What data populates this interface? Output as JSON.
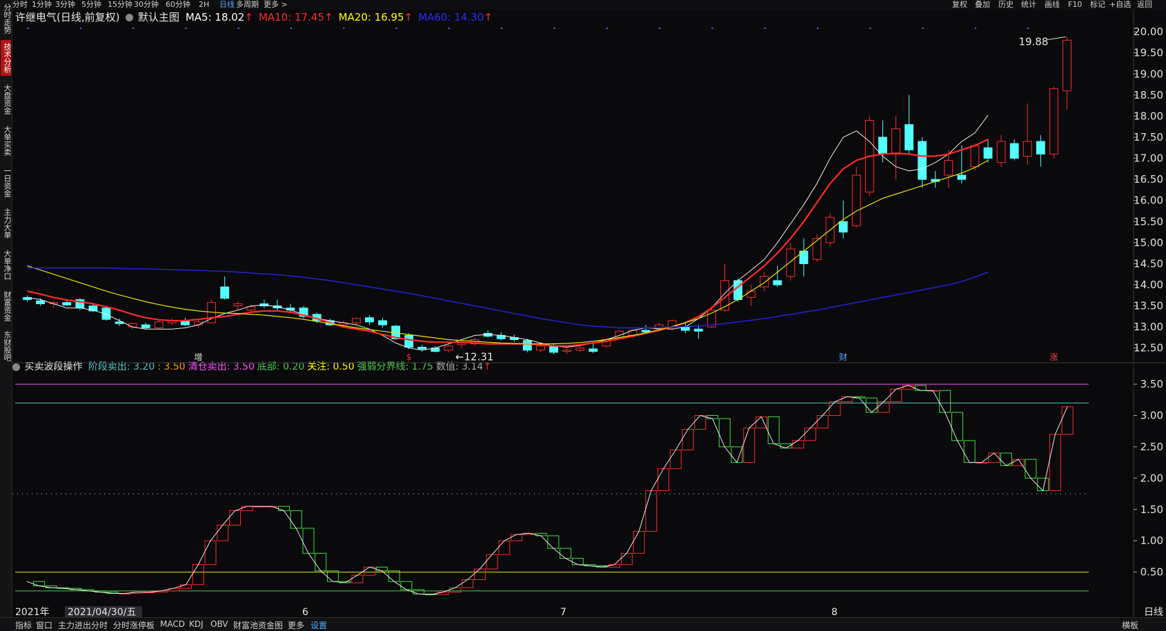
{
  "topbar": {
    "left": [
      "分时",
      "1分钟",
      "3分钟",
      "5分钟",
      "15分钟",
      "30分钟",
      "60分钟",
      "2H",
      "日线",
      "多周期",
      "更多 >"
    ],
    "active": "日线",
    "right": [
      "复权",
      "叠加",
      "历史",
      "统计",
      "画线",
      "F10",
      "标记",
      "+自选",
      "返回"
    ]
  },
  "sidebar": [
    "分时走势",
    "技术分析",
    "大盘资金",
    "大单买卖",
    "一日资金",
    "主力大单",
    "大单净口",
    "财富资金",
    "东财股吧"
  ],
  "sidebar_active": "技术分析",
  "main_chart": {
    "title": "许继电气(日线,前复权)",
    "template": "默认主图",
    "ma": [
      {
        "label": "MA5: 18.02",
        "color": "#ffffff"
      },
      {
        "label": "MA10: 17.45",
        "color": "#ff2a2a"
      },
      {
        "label": "MA20: 16.95",
        "color": "#ffff00"
      },
      {
        "label": "MA60: 14.30",
        "color": "#2a2aff"
      }
    ],
    "high_label": "19.88",
    "low_label": "12.31",
    "markers": [
      "增",
      "$",
      "财",
      "涨"
    ],
    "price_ticks": [
      "20.00",
      "19.50",
      "19.00",
      "18.50",
      "18.00",
      "17.50",
      "17.00",
      "16.50",
      "16.00",
      "15.50",
      "15.00",
      "14.50",
      "14.00",
      "13.50",
      "13.00",
      "12.50"
    ]
  },
  "indicator": {
    "name": "买卖波段操作",
    "params": [
      {
        "label": "阶段卖出: 3.20",
        "color": "#50c8c8"
      },
      {
        "label": ": 3.50",
        "color": "#ff9900"
      },
      {
        "label": "清仓卖出: 3.50",
        "color": "#ff50ff"
      },
      {
        "label": "底部: 0.20",
        "color": "#50c850"
      },
      {
        "label": "关注: 0.50",
        "color": "#ffff00"
      },
      {
        "label": "强弱分界线: 1.75",
        "color": "#50c850"
      },
      {
        "label": "数值: 3.14",
        "color": "#aaaaaa"
      }
    ],
    "ticks": [
      "3.50",
      "3.00",
      "2.50",
      "2.00",
      "1.50",
      "1.00",
      "0.50"
    ]
  },
  "x_axis": {
    "labels": [
      "2021年",
      "2021/04/30/五",
      "6",
      "7",
      "8"
    ],
    "period": "日线"
  },
  "bottombar": {
    "items": [
      "指标",
      "窗口",
      "主力进出分时",
      "分时涨停板",
      "MACD",
      "KDJ",
      "OBV",
      "财富池资金图",
      "更多",
      "设置"
    ],
    "right": "横板"
  },
  "colors": {
    "up": "#ff2a2a",
    "down": "#54ffff",
    "bg": "#0a0a0c",
    "accent": "#5aa8ff"
  },
  "chart_data": [
    {
      "type": "candlestick",
      "title": "许继电气(日线,前复权)",
      "series": [
        {
          "name": "MA5",
          "values": [
            13.7,
            13.65,
            13.55,
            13.45,
            13.45,
            13.4,
            13.3,
            13.15,
            13.0,
            12.95,
            12.95,
            12.95,
            12.98,
            13.05,
            13.2,
            13.32,
            13.4,
            13.5,
            13.52,
            13.48,
            13.4,
            13.3,
            13.2,
            13.15,
            13.1,
            13.05,
            12.95,
            12.8,
            12.62,
            12.5,
            12.45,
            12.5,
            12.6,
            12.7,
            12.8,
            12.82,
            12.8,
            12.75,
            12.7,
            12.62,
            12.55,
            12.52,
            12.56,
            12.62,
            12.7,
            12.8,
            12.92,
            12.98,
            12.96,
            12.95,
            13.0,
            13.2,
            13.45,
            13.8,
            14.1,
            14.35,
            14.6,
            15.0,
            15.45,
            15.9,
            16.4,
            17.0,
            17.5,
            17.65,
            17.4,
            17.05,
            16.8,
            16.7,
            16.75,
            16.9,
            17.1,
            17.4,
            17.6,
            18.02
          ]
        },
        {
          "name": "MA10",
          "values": [
            13.85,
            13.78,
            13.7,
            13.64,
            13.6,
            13.55,
            13.48,
            13.4,
            13.3,
            13.22,
            13.17,
            13.15,
            13.15,
            13.18,
            13.22,
            13.25,
            13.3,
            13.35,
            13.38,
            13.38,
            13.35,
            13.28,
            13.2,
            13.1,
            13.0,
            12.95,
            12.9,
            12.82,
            12.75,
            12.7,
            12.66,
            12.64,
            12.64,
            12.64,
            12.62,
            12.6,
            12.6,
            12.6,
            12.6,
            12.58,
            12.55,
            12.55,
            12.58,
            12.62,
            12.66,
            12.72,
            12.78,
            12.85,
            12.92,
            13.0,
            13.1,
            13.25,
            13.45,
            13.7,
            13.95,
            14.2,
            14.45,
            14.75,
            15.1,
            15.5,
            15.95,
            16.4,
            16.75,
            16.95,
            17.05,
            17.1,
            17.12,
            17.1,
            17.05,
            17.05,
            17.1,
            17.2,
            17.3,
            17.45
          ]
        },
        {
          "name": "MA20",
          "values": [
            14.45,
            14.35,
            14.25,
            14.15,
            14.05,
            13.95,
            13.85,
            13.76,
            13.68,
            13.6,
            13.53,
            13.47,
            13.42,
            13.38,
            13.35,
            13.33,
            13.32,
            13.3,
            13.28,
            13.25,
            13.22,
            13.18,
            13.13,
            13.08,
            13.03,
            12.98,
            12.94,
            12.9,
            12.86,
            12.82,
            12.78,
            12.74,
            12.7,
            12.68,
            12.66,
            12.64,
            12.62,
            12.61,
            12.6,
            12.6,
            12.6,
            12.61,
            12.63,
            12.66,
            12.7,
            12.75,
            12.8,
            12.86,
            12.93,
            13.01,
            13.1,
            13.2,
            13.33,
            13.48,
            13.65,
            13.85,
            14.05,
            14.3,
            14.55,
            14.8,
            15.05,
            15.3,
            15.55,
            15.75,
            15.9,
            16.05,
            16.15,
            16.25,
            16.35,
            16.45,
            16.55,
            16.65,
            16.78,
            16.95
          ]
        },
        {
          "name": "MA60",
          "values": [
            14.4,
            14.4,
            14.4,
            14.4,
            14.4,
            14.4,
            14.4,
            14.39,
            14.38,
            14.38,
            14.37,
            14.36,
            14.35,
            14.34,
            14.33,
            14.32,
            14.3,
            14.28,
            14.26,
            14.24,
            14.21,
            14.18,
            14.14,
            14.1,
            14.05,
            14.0,
            13.95,
            13.9,
            13.85,
            13.8,
            13.74,
            13.68,
            13.62,
            13.56,
            13.5,
            13.44,
            13.38,
            13.32,
            13.26,
            13.2,
            13.15,
            13.1,
            13.05,
            13.02,
            13.0,
            12.98,
            12.98,
            12.98,
            12.99,
            13.0,
            13.01,
            13.02,
            13.05,
            13.08,
            13.12,
            13.16,
            13.2,
            13.25,
            13.3,
            13.35,
            13.4,
            13.46,
            13.52,
            13.58,
            13.64,
            13.7,
            13.76,
            13.82,
            13.88,
            13.94,
            14.0,
            14.08,
            14.18,
            14.3
          ]
        }
      ],
      "ohlc": [
        [
          13.7,
          13.75,
          13.6,
          13.65
        ],
        [
          13.62,
          13.68,
          13.5,
          13.55
        ],
        [
          13.55,
          13.62,
          13.45,
          13.58
        ],
        [
          13.58,
          13.65,
          13.5,
          13.52
        ],
        [
          13.65,
          13.68,
          13.4,
          13.45
        ],
        [
          13.5,
          13.55,
          13.35,
          13.38
        ],
        [
          13.45,
          13.48,
          13.15,
          13.18
        ],
        [
          13.12,
          13.2,
          13.02,
          13.08
        ],
        [
          13.0,
          13.1,
          12.95,
          13.08
        ],
        [
          13.05,
          13.1,
          12.95,
          12.98
        ],
        [
          12.98,
          13.15,
          12.95,
          13.12
        ],
        [
          13.1,
          13.2,
          13.05,
          13.15
        ],
        [
          13.15,
          13.22,
          13.02,
          13.05
        ],
        [
          13.05,
          13.15,
          12.98,
          13.12
        ],
        [
          13.1,
          13.65,
          13.1,
          13.58
        ],
        [
          13.95,
          14.2,
          13.65,
          13.68
        ],
        [
          13.5,
          13.6,
          13.4,
          13.55
        ],
        [
          13.4,
          13.52,
          13.3,
          13.48
        ],
        [
          13.55,
          13.65,
          13.45,
          13.5
        ],
        [
          13.5,
          13.65,
          13.4,
          13.45
        ],
        [
          13.45,
          13.55,
          13.35,
          13.4
        ],
        [
          13.45,
          13.5,
          13.2,
          13.25
        ],
        [
          13.3,
          13.35,
          13.1,
          13.15
        ],
        [
          13.15,
          13.2,
          13.02,
          13.05
        ],
        [
          13.05,
          13.15,
          12.98,
          13.1
        ],
        [
          13.1,
          13.22,
          13.05,
          13.2
        ],
        [
          13.22,
          13.28,
          13.05,
          13.12
        ],
        [
          13.15,
          13.22,
          12.98,
          13.05
        ],
        [
          13.02,
          13.05,
          12.7,
          12.72
        ],
        [
          12.8,
          12.85,
          12.48,
          12.52
        ],
        [
          12.52,
          12.58,
          12.42,
          12.48
        ],
        [
          12.5,
          12.55,
          12.4,
          12.42
        ],
        [
          12.45,
          12.58,
          12.4,
          12.55
        ],
        [
          12.58,
          12.65,
          12.5,
          12.62
        ],
        [
          12.6,
          12.75,
          12.55,
          12.7
        ],
        [
          12.85,
          12.92,
          12.75,
          12.78
        ],
        [
          12.8,
          12.88,
          12.68,
          12.72
        ],
        [
          12.75,
          12.82,
          12.65,
          12.7
        ],
        [
          12.68,
          12.72,
          12.4,
          12.45
        ],
        [
          12.45,
          12.6,
          12.4,
          12.55
        ],
        [
          12.55,
          12.62,
          12.35,
          12.4
        ],
        [
          12.42,
          12.5,
          12.36,
          12.45
        ],
        [
          12.45,
          12.55,
          12.4,
          12.5
        ],
        [
          12.48,
          12.62,
          12.38,
          12.42
        ],
        [
          12.55,
          12.72,
          12.5,
          12.7
        ],
        [
          12.72,
          12.92,
          12.7,
          12.9
        ],
        [
          12.8,
          12.95,
          12.75,
          12.92
        ],
        [
          12.92,
          13.05,
          12.85,
          12.88
        ],
        [
          12.95,
          13.1,
          12.9,
          13.05
        ],
        [
          13.0,
          13.18,
          12.92,
          13.15
        ],
        [
          13.0,
          13.1,
          12.85,
          12.92
        ],
        [
          12.95,
          13.05,
          12.72,
          12.9
        ],
        [
          13.0,
          13.5,
          12.98,
          13.4
        ],
        [
          13.4,
          14.5,
          13.35,
          14.1
        ],
        [
          14.1,
          14.15,
          13.6,
          13.65
        ],
        [
          13.7,
          14.0,
          13.5,
          13.85
        ],
        [
          13.95,
          14.3,
          13.85,
          14.2
        ],
        [
          14.1,
          14.45,
          13.95,
          14.0
        ],
        [
          14.2,
          15.0,
          14.1,
          14.85
        ],
        [
          14.8,
          15.1,
          14.2,
          14.5
        ],
        [
          14.6,
          15.2,
          14.55,
          15.1
        ],
        [
          15.0,
          15.7,
          14.9,
          15.6
        ],
        [
          15.5,
          16.0,
          15.1,
          15.25
        ],
        [
          15.4,
          16.8,
          15.35,
          16.6
        ],
        [
          16.2,
          18.0,
          16.1,
          17.9
        ],
        [
          17.5,
          17.9,
          16.9,
          17.1
        ],
        [
          17.1,
          18.0,
          16.5,
          17.7
        ],
        [
          17.8,
          18.5,
          17.1,
          17.2
        ],
        [
          17.4,
          17.5,
          16.3,
          16.5
        ],
        [
          16.5,
          16.7,
          16.3,
          16.45
        ],
        [
          16.6,
          17.2,
          16.3,
          16.95
        ],
        [
          16.6,
          17.3,
          16.4,
          16.5
        ],
        [
          16.8,
          17.35,
          16.7,
          17.3
        ],
        [
          17.25,
          17.45,
          16.9,
          17.0
        ],
        [
          16.9,
          17.55,
          16.8,
          17.4
        ],
        [
          17.35,
          17.45,
          16.95,
          17.0
        ],
        [
          17.05,
          18.3,
          16.85,
          17.4
        ],
        [
          17.4,
          17.55,
          16.8,
          17.1
        ],
        [
          17.1,
          18.7,
          17.0,
          18.65
        ],
        [
          18.6,
          19.88,
          18.15,
          19.8
        ]
      ],
      "ylim": [
        12.31,
        20.0
      ]
    },
    {
      "type": "candlestick-indicator",
      "title": "买卖波段操作",
      "series": [
        {
          "name": "数值",
          "values": [
            0.35,
            0.28,
            0.25,
            0.24,
            0.22,
            0.2,
            0.18,
            0.16,
            0.16,
            0.18,
            0.18,
            0.2,
            0.24,
            0.3,
            0.62,
            1.0,
            1.25,
            1.48,
            1.55,
            1.55,
            1.55,
            1.48,
            1.2,
            0.8,
            0.52,
            0.35,
            0.33,
            0.45,
            0.58,
            0.52,
            0.35,
            0.22,
            0.15,
            0.14,
            0.18,
            0.25,
            0.38,
            0.55,
            0.78,
            1.0,
            1.1,
            1.12,
            1.08,
            0.88,
            0.72,
            0.62,
            0.6,
            0.58,
            0.62,
            0.8,
            1.15,
            1.8,
            2.15,
            2.45,
            2.78,
            3.0,
            2.95,
            2.5,
            2.25,
            2.8,
            2.98,
            2.55,
            2.48,
            2.6,
            2.8,
            3.0,
            3.22,
            3.3,
            3.28,
            3.05,
            3.22,
            3.42,
            3.48,
            3.4,
            3.4,
            3.05,
            2.6,
            2.25,
            2.25,
            2.4,
            2.2,
            2.3,
            2.0,
            1.8,
            2.7,
            3.14
          ]
        }
      ],
      "lines": {
        "清仓卖出": 3.5,
        "阶段卖出": 3.2,
        "强弱分界线": 1.75,
        "关注": 0.5,
        "底部": 0.2
      },
      "ylim": [
        0,
        3.6
      ]
    }
  ]
}
